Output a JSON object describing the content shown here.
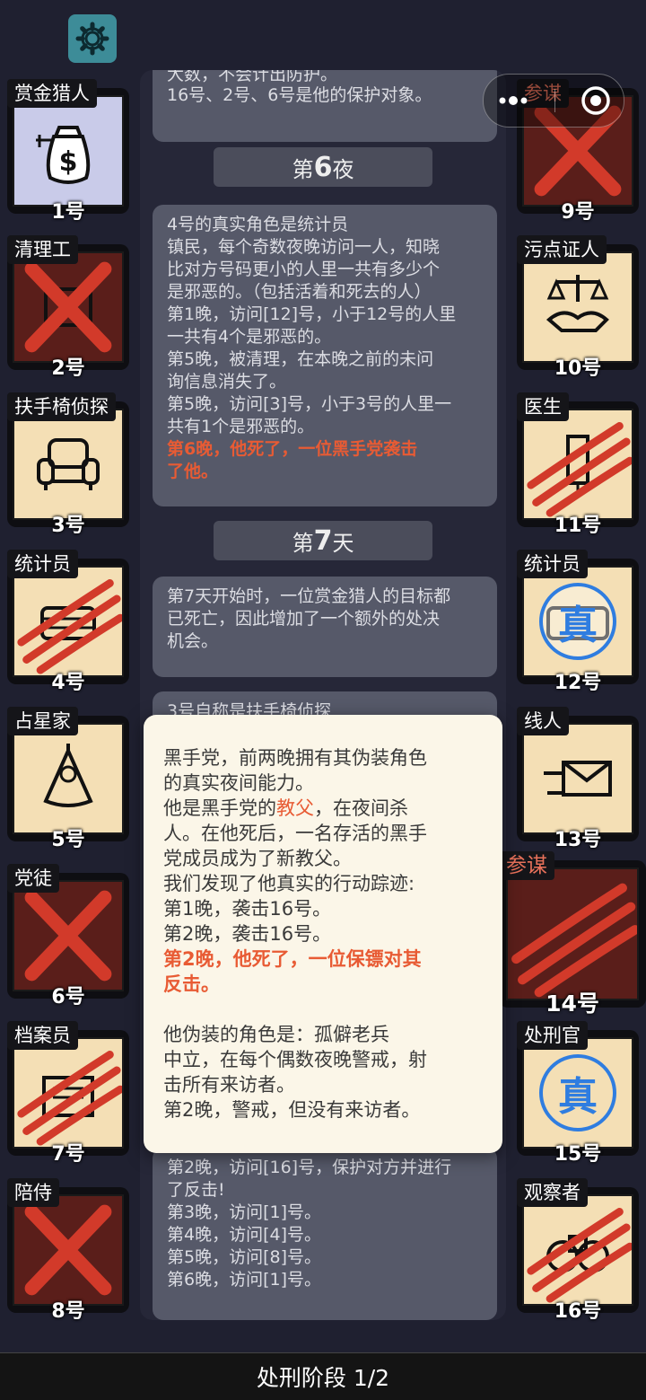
{
  "phase_label": "处刑阶段 1/2",
  "feed": {
    "top_fragment_1": "大数，不会计出防护。",
    "top_fragment_2": "16号、2号、6号是他的保护对象。",
    "night6_label_pre": "第",
    "night6_num": "6",
    "night6_label_post": "夜",
    "msg1": {
      "l1": "4号的真实角色是统计员",
      "l2": "镇民，每个奇数夜晚访问一人，知晓",
      "l3": "比对方号码更小的人里一共有多少个",
      "l4": "是邪恶的。（包括活着和死去的人）",
      "l5": "第1晚，访问[12]号，小于12号的人里",
      "l6": "一共有4个是邪恶的。",
      "l7": "第5晚，被清理，在本晚之前的未问",
      "l8": "询信息消失了。",
      "l9": "第5晚，访问[3]号，小于3号的人里一",
      "l10": "共有1个是邪恶的。",
      "l11": "第6晚，他死了，一位黑手党袭击",
      "l12": "了他。"
    },
    "day7_label_pre": "第",
    "day7_num": "7",
    "day7_label_post": "天",
    "msg2": {
      "l1": "第7天开始时，一位赏金猎人的目标都",
      "l2": "已死亡，因此增加了一个额外的处决",
      "l3": "机会。"
    },
    "msg3_fragment": "3号自称是扶手椅侦探",
    "msg4": {
      "l1": "第2晚，访问[16]号，保护对方并进行",
      "l2": "了反击!",
      "l3": "第3晚，访问[1]号。",
      "l4": "第4晚，访问[4]号。",
      "l5": "第5晚，访问[8]号。",
      "l6": "第6晚，访问[1]号。"
    }
  },
  "popup": {
    "l1": "黑手党，前两晚拥有其伪装角色",
    "l2": "的真实夜间能力。",
    "l3a": "他是黑手党的",
    "l3b": "教父",
    "l3c": "，在夜间杀",
    "l4": "人。在他死后，一名存活的黑手",
    "l5": "党成员成为了新教父。",
    "l6": "我们发现了他真实的行动踪迹:",
    "l7": "第1晚，袭击16号。",
    "l8": "第2晚，袭击16号。",
    "l9": "第2晚，他死了，一位保镖对其",
    "l10": "反击。",
    "l11": "他伪装的角色是：孤僻老兵",
    "l12": "中立，在每个偶数夜晚警戒，射",
    "l13": "击所有来访者。",
    "l14": "第2晚，警戒，但没有来访者。"
  },
  "players_left": [
    {
      "role": "赏金猎人",
      "num": "1号"
    },
    {
      "role": "清理工",
      "num": "2号"
    },
    {
      "role": "扶手椅侦探",
      "num": "3号"
    },
    {
      "role": "统计员",
      "num": "4号"
    },
    {
      "role": "占星家",
      "num": "5号"
    },
    {
      "role": "党徒",
      "num": "6号"
    },
    {
      "role": "档案员",
      "num": "7号"
    },
    {
      "role": "陪侍",
      "num": "8号"
    }
  ],
  "players_right": [
    {
      "role": "参谋",
      "num": "9号"
    },
    {
      "role": "污点证人",
      "num": "10号"
    },
    {
      "role": "医生",
      "num": "11号"
    },
    {
      "role": "统计员",
      "num": "12号"
    },
    {
      "role": "线人",
      "num": "13号"
    },
    {
      "role": "参谋",
      "num": "14号"
    },
    {
      "role": "处刑官",
      "num": "15号"
    },
    {
      "role": "观察者",
      "num": "16号"
    }
  ],
  "verified_badge": "真",
  "colors": {
    "accent": "#e85b34",
    "verified": "#2f7de0",
    "cross": "#d23a2a"
  }
}
